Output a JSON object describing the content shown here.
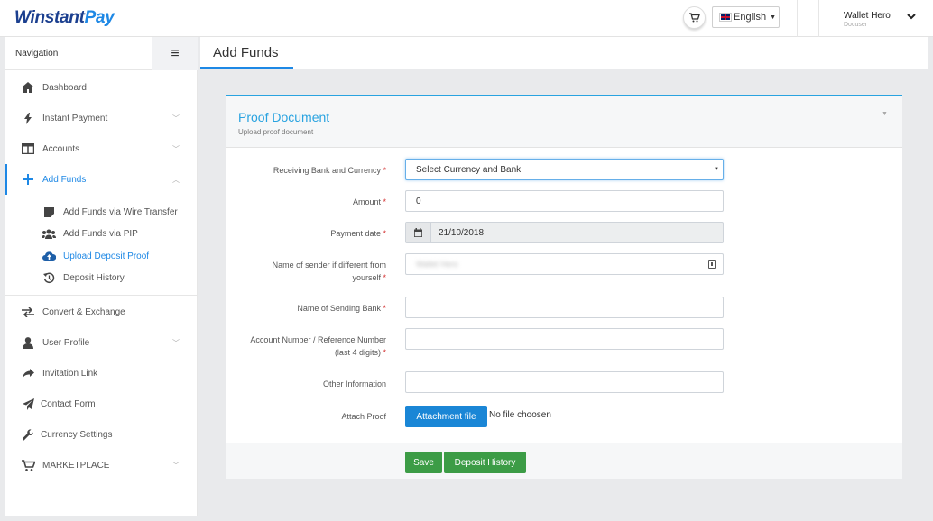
{
  "header": {
    "logo_part1": "Winstant",
    "logo_part2": "Pay",
    "language": "English",
    "user_name": "Wallet Hero",
    "user_role": "Docuser"
  },
  "sidebar": {
    "title": "Navigation",
    "items": [
      {
        "label": "Dashboard",
        "icon": "home-icon"
      },
      {
        "label": "Instant Payment",
        "icon": "bolt-icon",
        "expandable": true
      },
      {
        "label": "Accounts",
        "icon": "columns-icon",
        "expandable": true
      },
      {
        "label": "Add Funds",
        "icon": "plus-icon",
        "expandable": true,
        "active": true
      },
      {
        "label": "Convert & Exchange",
        "icon": "exchange-icon"
      },
      {
        "label": "User Profile",
        "icon": "user-icon",
        "expandable": true
      },
      {
        "label": "Invitation Link",
        "icon": "share-icon"
      },
      {
        "label": "Contact Form",
        "icon": "paper-plane-icon"
      },
      {
        "label": "Currency Settings",
        "icon": "wrench-icon"
      },
      {
        "label": "MARKETPLACE",
        "icon": "cart-icon",
        "expandable": true
      }
    ],
    "subitems": [
      {
        "label": "Add Funds via Wire Transfer",
        "icon": "note-icon"
      },
      {
        "label": "Add Funds via PIP",
        "icon": "users-icon"
      },
      {
        "label": "Upload Deposit Proof",
        "icon": "cloud-upload-icon",
        "active": true
      },
      {
        "label": "Deposit History",
        "icon": "history-icon"
      }
    ]
  },
  "page": {
    "title": "Add Funds"
  },
  "panel": {
    "title": "Proof Document",
    "subtitle": "Upload proof document"
  },
  "form": {
    "bank_label": "Receiving Bank and Currency",
    "bank_value": "Select Currency and Bank",
    "amount_label": "Amount",
    "amount_value": "0",
    "date_label": "Payment date",
    "date_value": "21/10/2018",
    "sender_label_1": "Name of sender if different from",
    "sender_label_2": "yourself",
    "sender_value": "Wallet Hero",
    "sending_bank_label": "Name of Sending Bank",
    "account_label_1": "Account Number / Reference Number",
    "account_label_2": "(last 4 digits)",
    "other_label": "Other Information",
    "attach_label": "Attach Proof",
    "attach_button": "Attachment file",
    "no_file": "No file choosen",
    "required_mark": "*"
  },
  "actions": {
    "save": "Save",
    "history": "Deposit History"
  },
  "colors": {
    "accent": "#1e88e5",
    "panel_accent": "#29a3e0",
    "success": "#3c9c46",
    "required": "#d32f2f"
  }
}
